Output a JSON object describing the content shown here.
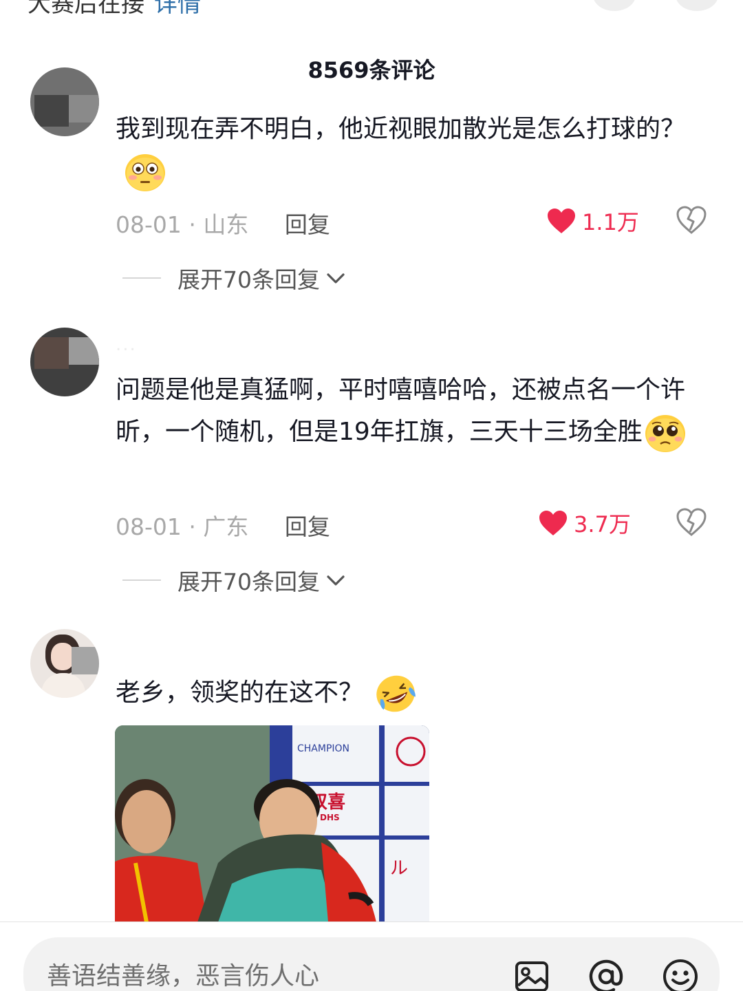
{
  "top": {
    "clipped_text": "大赛后在接",
    "clipped_link": "详情"
  },
  "header": {
    "title": "8569条评论"
  },
  "comments": [
    {
      "text": "我到现在弄不明白，他近视眼加散光是怎么打球的？",
      "date": "08-01",
      "location": "山东",
      "reply_label": "回复",
      "likes": "1.1万",
      "expand_label": "展开70条回复"
    },
    {
      "username": "...",
      "text": "问题是他是真猛啊，平时嘻嘻哈哈，还被点名一个许昕，一个随机，但是19年扛旗，三天十三场全胜",
      "date": "08-01",
      "location": "广东",
      "reply_label": "回复",
      "likes": "3.7万",
      "expand_label": "展开70条回复"
    },
    {
      "text": "老乡，领奖的在这不？"
    }
  ],
  "photo_sign": {
    "top": "CHAMPION",
    "mid": "双喜",
    "sub": "DHS"
  },
  "input_bar": {
    "placeholder": "善语结善缘，恶言伤人心"
  },
  "icons": [
    "image-icon",
    "mention-icon",
    "emoji-icon",
    "heart-icon",
    "dislike-heart-icon",
    "chevron-down-icon"
  ],
  "colors": {
    "like_red": "#ee2a4f",
    "text": "#161823",
    "meta": "#a8a8a8"
  }
}
